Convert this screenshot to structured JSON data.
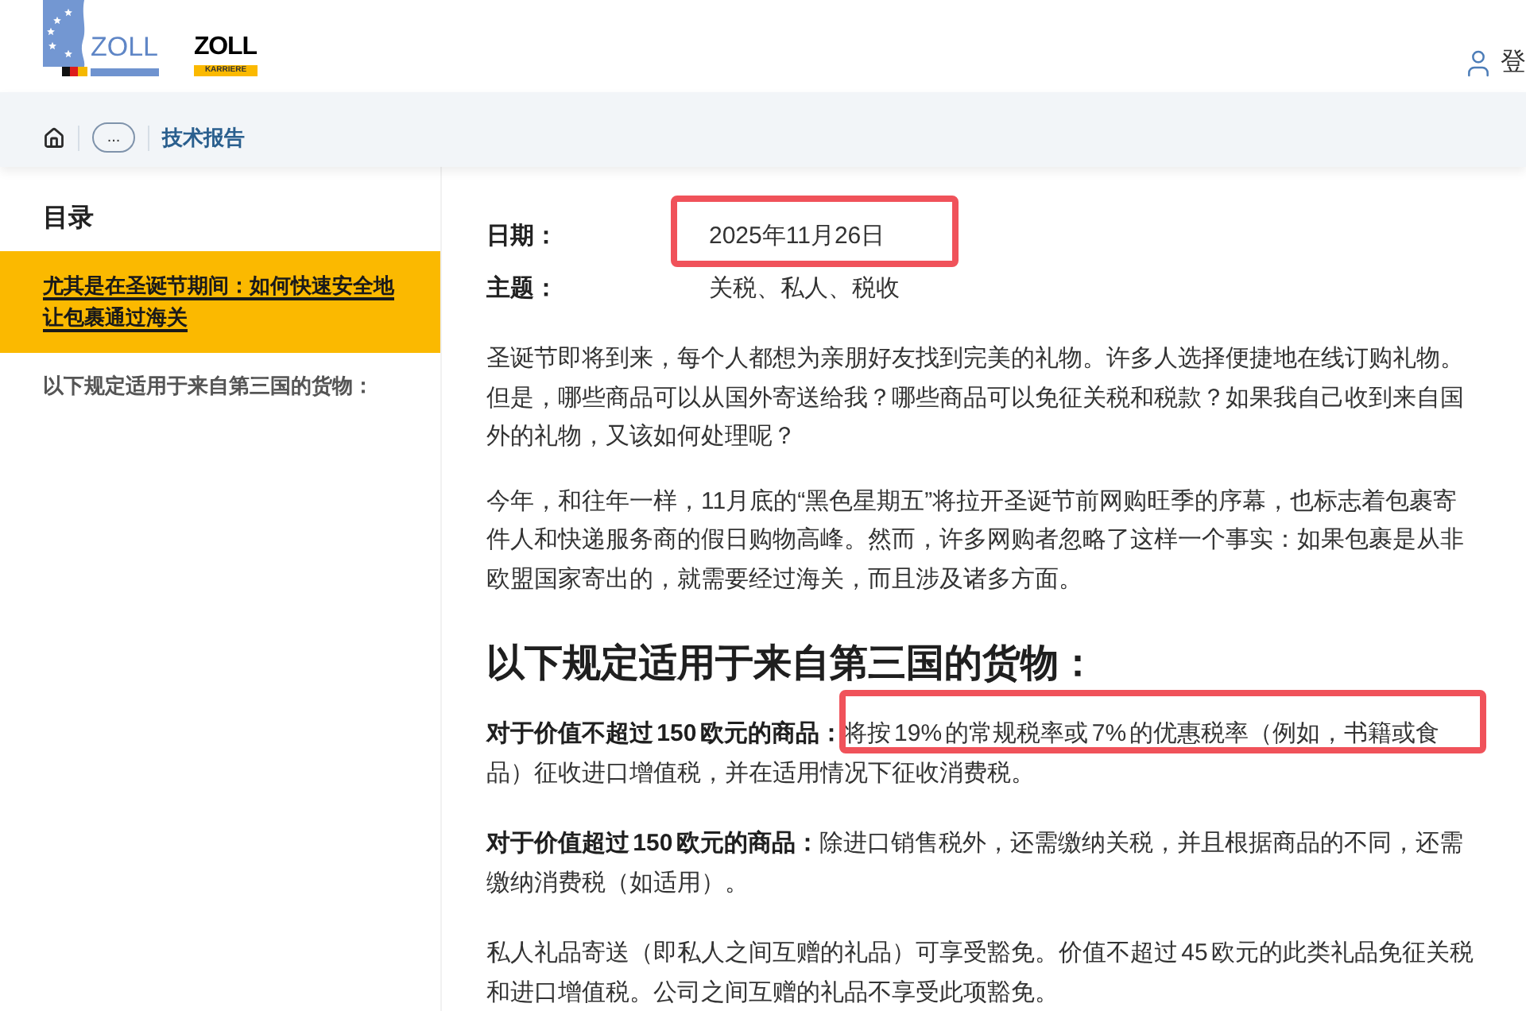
{
  "header": {
    "logos": [
      {
        "kind": "flag",
        "text": "ZOLL"
      },
      {
        "kind": "career",
        "text": "ZOLL",
        "tagline": "KARRIERE"
      }
    ],
    "login": {
      "label": "登"
    }
  },
  "breadcrumb": {
    "collapsed": "...",
    "current": "技术报告"
  },
  "toc": {
    "title": "目录",
    "items": [
      {
        "label": "尤其是在圣诞节期间：如何快速安全地让包裹通过海关",
        "selected": true
      },
      {
        "label": "以下规定适用于来自第三国的货物：",
        "selected": false
      }
    ]
  },
  "article": {
    "meta": [
      {
        "label": "日期：",
        "value": "2025年11月26日",
        "highlighted": true
      },
      {
        "label": "主题：",
        "value": "关税、私人、税收",
        "highlighted": false
      }
    ],
    "intro": [
      "圣诞节即将到来，每个人都想为亲朋好友找到完美的礼物。许多人选择便捷地在线订购礼物。但是，哪些商品可以从国外寄送给我？哪些商品可以免征关税和税款？如果我自己收到来自国外的礼物，又该如何处理呢？",
      "今年，和往年一样，11月底的“黑色星期五”将拉开圣诞节前网购旺季的序幕，也标志着包裹寄件人和快递服务商的假日购物高峰。然而，许多网购者忽略了这样一个事实：如果包裹是从非欧盟国家寄出的，就需要经过海关，而且涉及诸多方面。"
    ],
    "section": {
      "heading": "以下规定适用于来自第三国的货物：",
      "paragraphs": [
        {
          "text": "**对于价值不超过 150 欧元的商品：**将按 19% 的常规税率或 7% 的优惠税率（例如，书籍或食品）征收进口增值税，并在适用情况下征收消费税。",
          "highlighted": true
        },
        {
          "text": "**对于价值超过 150 欧元的商品：**除进口销售税外，还需缴纳关税，并且根据商品的不同，还需缴纳消费税（如适用）。",
          "highlighted": false
        },
        {
          "text": "私人礼品寄送（即私人之间互赠的礼品）可享受豁免。价值不超过 45 欧元的此类礼品免征关税和进口增值税。公司之间互赠的礼品不享受此项豁免。",
          "highlighted": false
        }
      ]
    }
  }
}
